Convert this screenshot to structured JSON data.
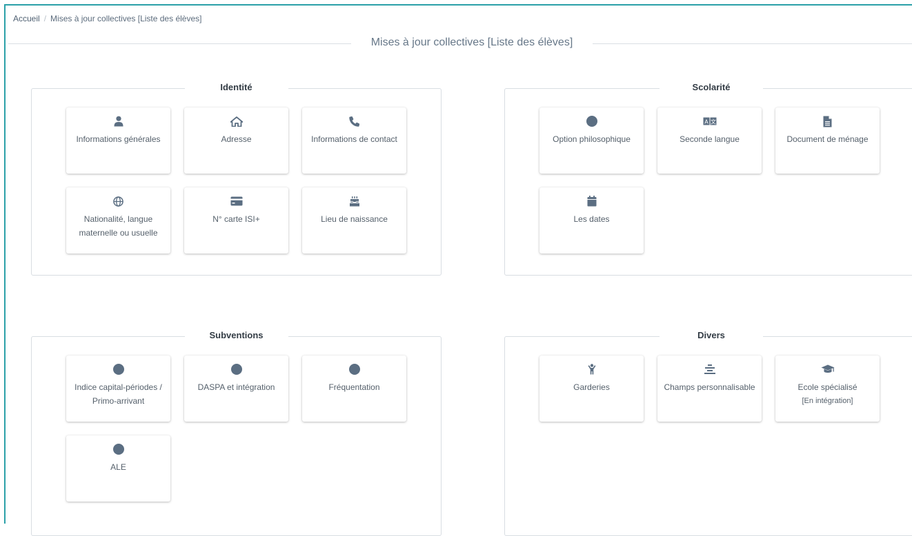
{
  "breadcrumb": {
    "home": "Accueil",
    "current": "Mises à jour collectives [Liste des élèves]"
  },
  "page_title": "Mises à jour collectives [Liste des élèves]",
  "icon_color": "#5b6e82",
  "sections": {
    "identite": {
      "title": "Identité",
      "cards": [
        {
          "label": "Informations générales",
          "icon": "user-icon"
        },
        {
          "label": "Adresse",
          "icon": "home-icon"
        },
        {
          "label": "Informations de contact",
          "icon": "phone-icon"
        },
        {
          "label": "Nationalité, langue maternelle ou usuelle",
          "icon": "globe-icon"
        },
        {
          "label": "N° carte ISI+",
          "icon": "credit-card-icon"
        },
        {
          "label": "Lieu de naissance",
          "icon": "birthday-cake-icon"
        }
      ]
    },
    "scolarite": {
      "title": "Scolarité",
      "cards": [
        {
          "label": "Option philosophique",
          "icon": "circle-icon"
        },
        {
          "label": "Seconde langue",
          "icon": "translate-icon"
        },
        {
          "label": "Document de ménage",
          "icon": "document-icon"
        },
        {
          "label": "Les dates",
          "icon": "calendar-icon"
        }
      ]
    },
    "subventions": {
      "title": "Subventions",
      "cards": [
        {
          "label": "Indice capital-périodes / Primo-arrivant",
          "icon": "circle-icon"
        },
        {
          "label": "DASPA et intégration",
          "icon": "circle-icon"
        },
        {
          "label": "Fréquentation",
          "icon": "circle-icon"
        },
        {
          "label": "ALE",
          "icon": "circle-icon"
        }
      ]
    },
    "divers": {
      "title": "Divers",
      "cards": [
        {
          "label": "Garderies",
          "icon": "child-icon"
        },
        {
          "label": "Champs personnalisable",
          "icon": "align-center-icon"
        },
        {
          "label": "Ecole spécialisé",
          "sub": "[En intégration]",
          "icon": "graduation-cap-icon"
        }
      ]
    }
  }
}
